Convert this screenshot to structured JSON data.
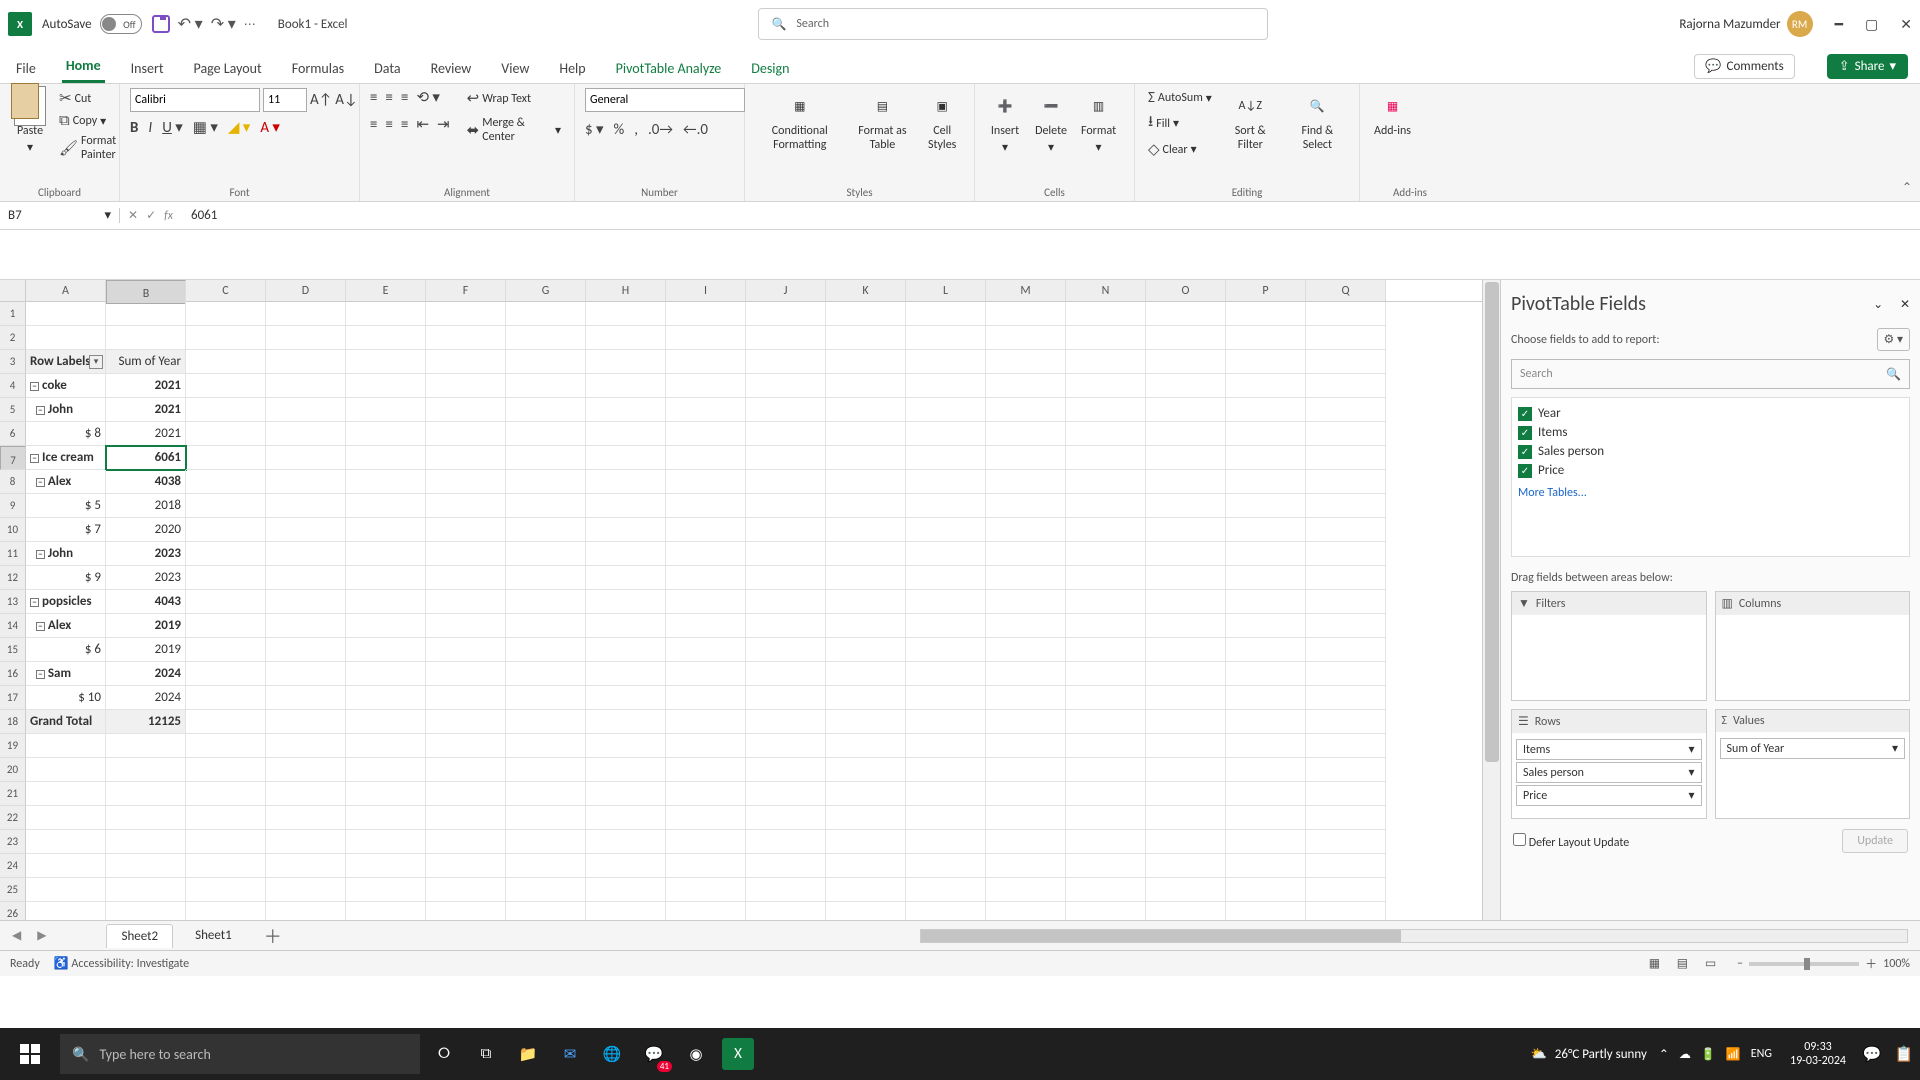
{
  "title": {
    "autosave": "AutoSave",
    "autosave_state": "Off",
    "book": "Book1  -  Excel",
    "search_ph": "Search",
    "user": "Rajorna Mazumder",
    "initials": "RM"
  },
  "tabs": {
    "items": [
      "File",
      "Home",
      "Insert",
      "Page Layout",
      "Formulas",
      "Data",
      "Review",
      "View",
      "Help",
      "PivotTable Analyze",
      "Design"
    ],
    "active": "Home",
    "comments": "Comments",
    "share": "Share"
  },
  "ribbon": {
    "clipboard": {
      "paste": "Paste",
      "cut": "Cut",
      "copy": "Copy",
      "painter": "Format Painter",
      "label": "Clipboard"
    },
    "font": {
      "name": "Calibri",
      "size": "11",
      "label": "Font"
    },
    "align": {
      "wrap": "Wrap Text",
      "merge": "Merge & Center",
      "label": "Alignment"
    },
    "number": {
      "format": "General",
      "label": "Number"
    },
    "styles": {
      "cond": "Conditional Formatting",
      "table": "Format as Table",
      "cell": "Cell Styles",
      "label": "Styles"
    },
    "cells": {
      "insert": "Insert",
      "delete": "Delete",
      "format": "Format",
      "label": "Cells"
    },
    "editing": {
      "autosum": "AutoSum",
      "fill": "Fill",
      "clear": "Clear",
      "sort": "Sort & Filter",
      "find": "Find & Select",
      "label": "Editing"
    },
    "addins": {
      "addins": "Add-ins",
      "label": "Add-ins"
    }
  },
  "formula": {
    "ref": "B7",
    "fx": "fx",
    "value": "6061"
  },
  "columns": [
    "A",
    "B",
    "C",
    "D",
    "E",
    "F",
    "G",
    "H",
    "I",
    "J",
    "K",
    "L",
    "M",
    "N",
    "O",
    "P",
    "Q"
  ],
  "grid": {
    "header_a": "Row Labels",
    "header_b": "Sum of Year",
    "rows": [
      {
        "n": 1,
        "a": "",
        "b": ""
      },
      {
        "n": 2,
        "a": "",
        "b": ""
      },
      {
        "n": 3,
        "a": "Row Labels",
        "b": "Sum of Year",
        "hdr": true,
        "dd": true
      },
      {
        "n": 4,
        "a": "coke",
        "b": "2021",
        "lvl": 0,
        "bold": true
      },
      {
        "n": 5,
        "a": "John",
        "b": "2021",
        "lvl": 1,
        "bold": true
      },
      {
        "n": 6,
        "a": "$ 8",
        "b": "2021",
        "lvl": 2
      },
      {
        "n": 7,
        "a": "Ice cream",
        "b": "6061",
        "lvl": 0,
        "bold": true,
        "active": true
      },
      {
        "n": 8,
        "a": "Alex",
        "b": "4038",
        "lvl": 1,
        "bold": true
      },
      {
        "n": 9,
        "a": "$ 5",
        "b": "2018",
        "lvl": 2
      },
      {
        "n": 10,
        "a": "$ 7",
        "b": "2020",
        "lvl": 2
      },
      {
        "n": 11,
        "a": "John",
        "b": "2023",
        "lvl": 1,
        "bold": true
      },
      {
        "n": 12,
        "a": "$ 9",
        "b": "2023",
        "lvl": 2
      },
      {
        "n": 13,
        "a": "popsicles",
        "b": "4043",
        "lvl": 0,
        "bold": true
      },
      {
        "n": 14,
        "a": "Alex",
        "b": "2019",
        "lvl": 1,
        "bold": true
      },
      {
        "n": 15,
        "a": "$ 6",
        "b": "2019",
        "lvl": 2
      },
      {
        "n": 16,
        "a": "Sam",
        "b": "2024",
        "lvl": 1,
        "bold": true
      },
      {
        "n": 17,
        "a": "$ 10",
        "b": "2024",
        "lvl": 2
      },
      {
        "n": 18,
        "a": "Grand Total",
        "b": "12125",
        "bold": true,
        "gt": true
      },
      {
        "n": 19,
        "a": "",
        "b": ""
      },
      {
        "n": 20,
        "a": "",
        "b": ""
      },
      {
        "n": 21,
        "a": "",
        "b": ""
      },
      {
        "n": 22,
        "a": "",
        "b": ""
      },
      {
        "n": 23,
        "a": "",
        "b": ""
      },
      {
        "n": 24,
        "a": "",
        "b": ""
      },
      {
        "n": 25,
        "a": "",
        "b": ""
      },
      {
        "n": 26,
        "a": "",
        "b": ""
      }
    ]
  },
  "pivot": {
    "title": "PivotTable Fields",
    "choose": "Choose fields to add to report:",
    "search_ph": "Search",
    "fields": [
      "Year",
      "Items",
      "Sales person",
      "Price"
    ],
    "more": "More Tables...",
    "drag": "Drag fields between areas below:",
    "areas": {
      "filters": "Filters",
      "columns": "Columns",
      "rows": "Rows",
      "values": "Values"
    },
    "row_items": [
      "Items",
      "Sales person",
      "Price"
    ],
    "value_items": [
      "Sum of Year"
    ],
    "defer": "Defer Layout Update",
    "update": "Update"
  },
  "sheets": {
    "active": "Sheet2",
    "other": "Sheet1"
  },
  "status": {
    "ready": "Ready",
    "acc": "Accessibility: Investigate",
    "zoom": "100%"
  },
  "taskbar": {
    "search": "Type here to search",
    "weather": "26°C  Partly sunny",
    "lang": "ENG",
    "time": "09:33",
    "date": "19-03-2024",
    "wa_badge": "41"
  }
}
